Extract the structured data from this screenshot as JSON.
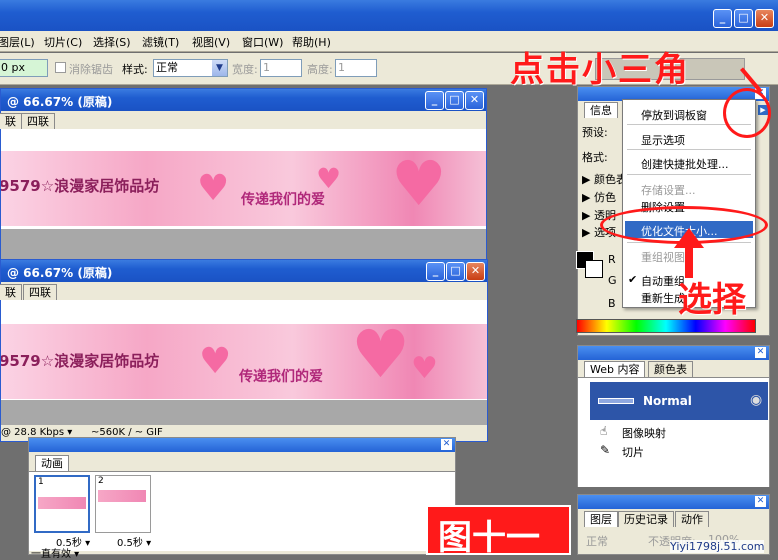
{
  "window": {
    "min": "_",
    "max": "□",
    "close": "✕"
  },
  "menu_bar": [
    "图层(L)",
    "切片(C)",
    "选择(S)",
    "滤镜(T)",
    "视图(V)",
    "窗口(W)",
    "帮助(H)"
  ],
  "options_bar": {
    "feather_value": "0 px",
    "antialias_label": "消除锯齿",
    "style_label": "样式:",
    "style_value": "正常",
    "width_label": "宽度:",
    "width_value": "1",
    "height_label": "高度:",
    "height_value": "1"
  },
  "doc1": {
    "title": "@ 66.67% (原稿)",
    "tabs": [
      "联",
      "四联"
    ],
    "banner_left": "9579☆浪漫家居饰品坊",
    "banner_right": "传递我们的爱"
  },
  "doc2": {
    "title": "@ 66.67% (原稿)",
    "tabs": [
      "联",
      "四联"
    ],
    "banner_left": "9579☆浪漫家居饰品坊",
    "banner_right": "传递我们的爱",
    "status_speed": "@ 28.8 Kbps ▾",
    "status_size": "~560K / ~ GIF"
  },
  "animation": {
    "tab": "动画",
    "frames": [
      {
        "num": "1",
        "delay": "0.5秒 ▾"
      },
      {
        "num": "2",
        "delay": "0.5秒 ▾"
      }
    ],
    "loop": "一直有效 ▾"
  },
  "info_panel": {
    "tab": "信息",
    "preset_label": "预设:",
    "format_label": "格式:",
    "rows": [
      "颜色表",
      "仿色",
      "透明",
      "选项"
    ]
  },
  "flyout_menu": {
    "items": [
      {
        "label": "停放到调板窗",
        "disabled": false
      },
      {
        "label": "显示选项",
        "disabled": false
      },
      {
        "label": "创建快捷批处理...",
        "disabled": false
      },
      {
        "label": "存储设置...",
        "disabled": true
      },
      {
        "label": "删除设置",
        "disabled": false
      },
      {
        "label": "优化文件大小...",
        "disabled": false,
        "highlighted": true
      },
      {
        "label": "重组视图",
        "disabled": true
      },
      {
        "label": "自动重组",
        "disabled": false,
        "checked": true
      },
      {
        "label": "重新生成",
        "disabled": false
      }
    ]
  },
  "color_panel": {
    "r": "R",
    "g": "G",
    "b": "B"
  },
  "web_panel": {
    "tabs": [
      "Web 内容",
      "颜色表"
    ],
    "normal": "Normal",
    "items": [
      "图像映射",
      "切片"
    ]
  },
  "layers_panel": {
    "tabs": [
      "图层",
      "历史记录",
      "动作"
    ],
    "mode": "正常",
    "opacity_label": "不透明度:",
    "opacity": "100%"
  },
  "annotations": {
    "click_triangle": "点击小三角",
    "select": "选择",
    "figure": "图十一",
    "watermark": "Yiyi1798j.51.com"
  },
  "colors": {
    "accent_red": "#ff1a1a",
    "xp_blue": "#1f5dd0",
    "highlight": "#316ac5"
  }
}
